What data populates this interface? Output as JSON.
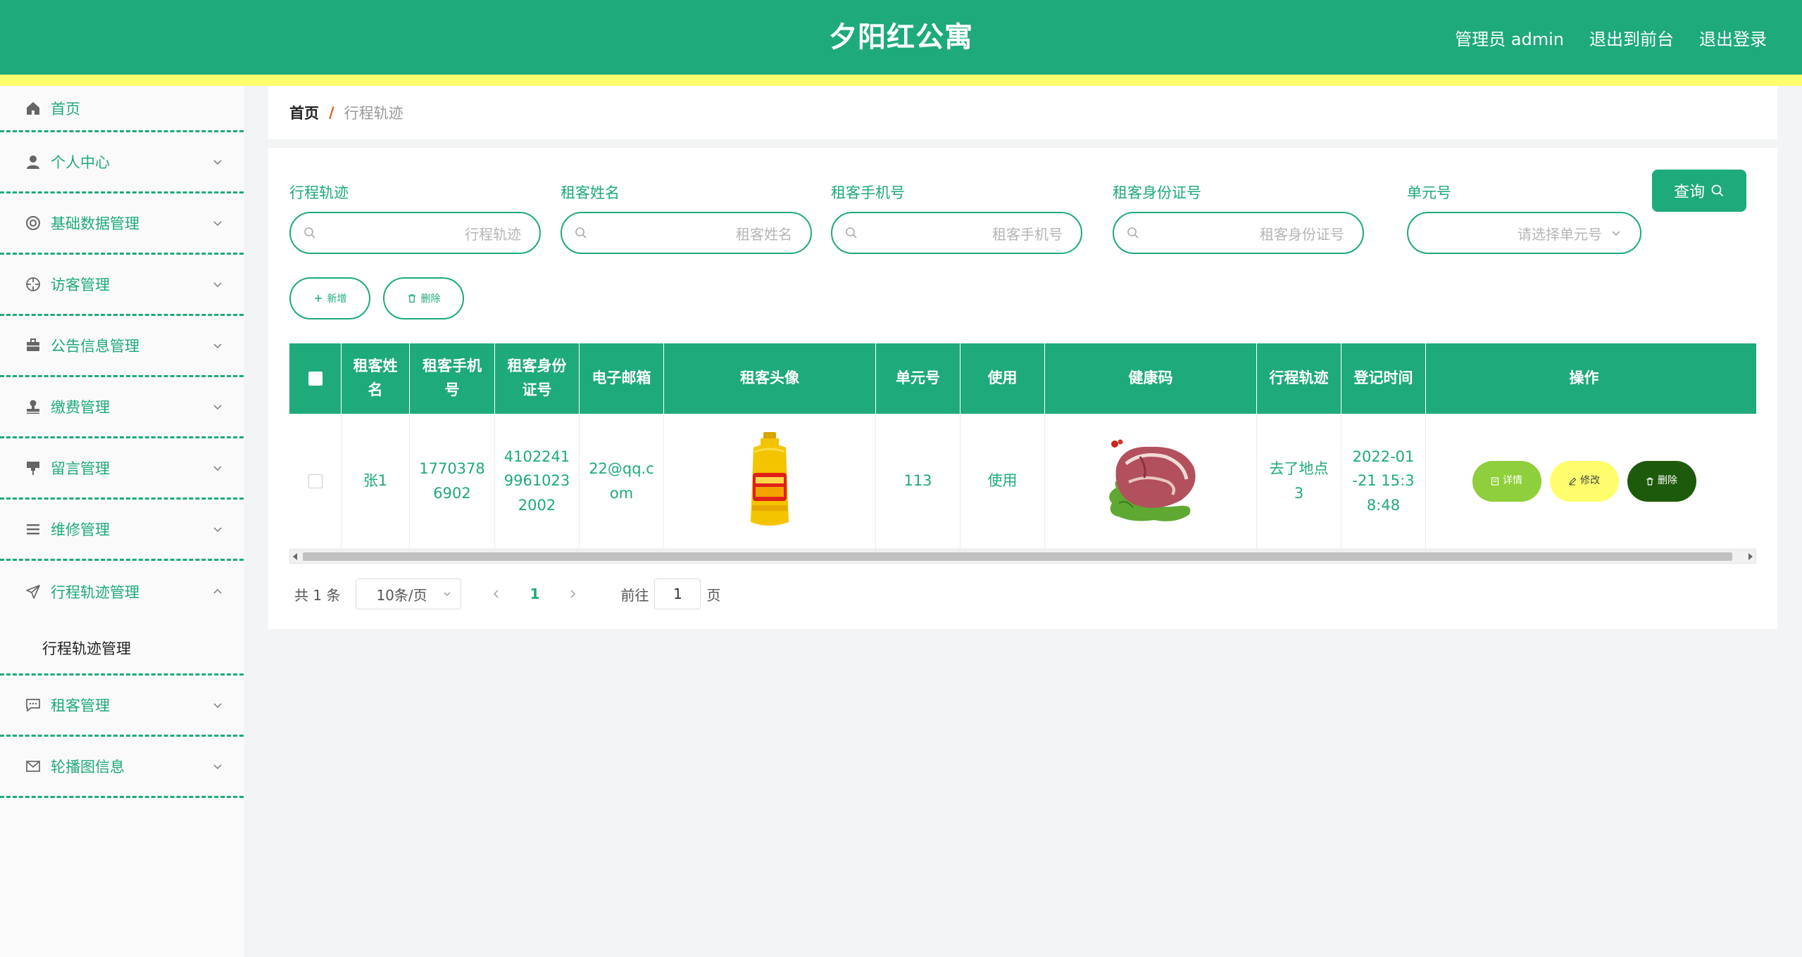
{
  "header": {
    "title": "夕阳红公寓",
    "admin_label": "管理员 admin",
    "front_link": "退出到前台",
    "logout_link": "退出登录"
  },
  "sidebar": {
    "items": [
      {
        "label": "首页",
        "icon": "home-icon"
      },
      {
        "label": "个人中心",
        "icon": "user-icon"
      },
      {
        "label": "基础数据管理",
        "icon": "help-circle-icon"
      },
      {
        "label": "访客管理",
        "icon": "crosshair-icon"
      },
      {
        "label": "公告信息管理",
        "icon": "briefcase-icon"
      },
      {
        "label": "缴费管理",
        "icon": "stamp-icon"
      },
      {
        "label": "留言管理",
        "icon": "message-pin-icon"
      },
      {
        "label": "维修管理",
        "icon": "list-icon"
      },
      {
        "label": "行程轨迹管理",
        "icon": "send-icon"
      },
      {
        "label": "租客管理",
        "icon": "chat-icon"
      },
      {
        "label": "轮播图信息",
        "icon": "mail-icon"
      }
    ],
    "submenu": {
      "label": "行程轨迹管理"
    }
  },
  "breadcrumb": {
    "home": "首页",
    "separator": "/",
    "current": "行程轨迹"
  },
  "filters": {
    "trip": {
      "label": "行程轨迹",
      "placeholder": "行程轨迹"
    },
    "name": {
      "label": "租客姓名",
      "placeholder": "租客姓名"
    },
    "phone": {
      "label": "租客手机号",
      "placeholder": "租客手机号"
    },
    "idcard": {
      "label": "租客身份证号",
      "placeholder": "租客身份证号"
    },
    "unit": {
      "label": "单元号",
      "placeholder": "请选择单元号"
    },
    "query_button": "查询"
  },
  "actions": {
    "add": "新增",
    "delete": "删除"
  },
  "table": {
    "headers": [
      "租客姓名",
      "租客手机号",
      "租客身份证号",
      "电子邮箱",
      "租客头像",
      "单元号",
      "使用",
      "健康码",
      "行程轨迹",
      "登记时间",
      "操作"
    ],
    "rows": [
      {
        "name": "张1",
        "phone": "17703786902",
        "idcard": "410224199610232002",
        "email": "22@qq.com",
        "unit": "113",
        "usage": "使用",
        "trip": "去了地点3",
        "time": "2022-01-21 15:38:48"
      }
    ],
    "row_actions": {
      "detail": "详情",
      "edit": "修改",
      "delete": "删除"
    }
  },
  "pagination": {
    "total": "共 1 条",
    "page_size": "10条/页",
    "current_page": "1",
    "goto_label": "前往",
    "goto_value": "1",
    "page_suffix": "页"
  },
  "colors": {
    "primary": "#1eaa7a",
    "accent_yellow": "#ffff6e",
    "detail_green": "#8fcf3c",
    "delete_dark": "#1e5a0c"
  }
}
